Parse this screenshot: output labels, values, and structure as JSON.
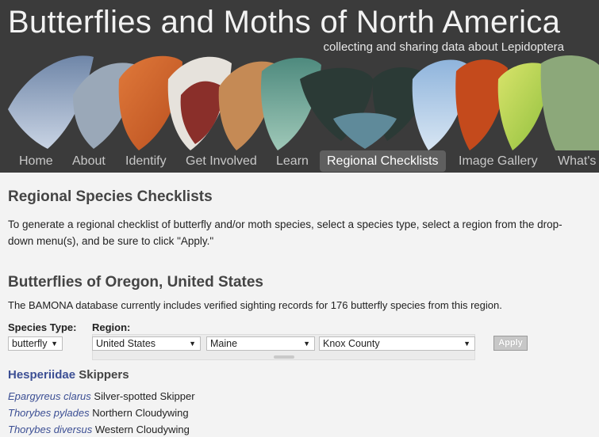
{
  "site": {
    "title": "Butterflies and Moths of North America",
    "tagline": "collecting and sharing data about Lepidoptera"
  },
  "nav": [
    {
      "label": "Home"
    },
    {
      "label": "About"
    },
    {
      "label": "Identify"
    },
    {
      "label": "Get Involved"
    },
    {
      "label": "Learn"
    },
    {
      "label": "Regional Checklists",
      "active": true
    },
    {
      "label": "Image Gallery"
    },
    {
      "label": "What's"
    }
  ],
  "page": {
    "title": "Regional Species Checklists",
    "intro": "To generate a regional checklist of butterfly and/or moth species, select a species type, select a region from the drop-down menu(s), and be sure to click \"Apply.\""
  },
  "checklist": {
    "title": "Butterflies of Oregon, United States",
    "note": "The BAMONA database currently includes verified sighting records for 176 butterfly species from this region."
  },
  "filters": {
    "species_type_label": "Species Type:",
    "species_type_value": "butterfly",
    "region_label": "Region:",
    "country_value": "United States",
    "state_value": "Maine",
    "county_value": "Knox County",
    "apply_label": "Apply"
  },
  "family": {
    "scientific": "Hesperiidae",
    "common": "Skippers"
  },
  "species": [
    {
      "scientific": "Epargyreus clarus",
      "common": "Silver-spotted Skipper"
    },
    {
      "scientific": "Thorybes pylades",
      "common": "Northern Cloudywing"
    },
    {
      "scientific": "Thorybes diversus",
      "common": "Western Cloudywing"
    }
  ],
  "colors": {
    "banner_bg": "#3b3b3b",
    "link": "#3c4f94",
    "page_bg": "#f3f3f3"
  }
}
